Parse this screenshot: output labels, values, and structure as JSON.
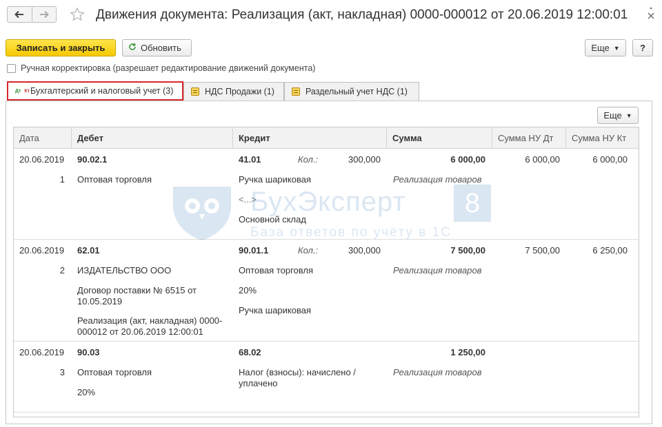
{
  "window": {
    "title": "Движения документа: Реализация (акт, накладная) 0000-000012 от 20.06.2019 12:00:01"
  },
  "toolbar": {
    "save_close_label": "Записать и закрыть",
    "refresh_label": "Обновить",
    "more_label": "Еще",
    "help_label": "?"
  },
  "manual_adjust_label": "Ручная корректировка (разрешает редактирование движений документа)",
  "tabs": [
    {
      "label": "Бухгалтерский и налоговый учет (3)",
      "active": true,
      "icon": "dt-kt-icon"
    },
    {
      "label": "НДС Продажи (1)",
      "active": false,
      "icon": "register-icon"
    },
    {
      "label": "Раздельный учет НДС (1)",
      "active": false,
      "icon": "register-icon"
    }
  ],
  "panel": {
    "more_label": "Еще"
  },
  "dtkt": {
    "dt": "Дт",
    "kt": "Кт"
  },
  "table": {
    "columns": [
      "Дата",
      "Дебет",
      "Кредит",
      "Сумма",
      "Сумма НУ Дт",
      "Сумма НУ Кт"
    ],
    "rows": [
      {
        "date": "20.06.2019",
        "num": "1",
        "debit_account": "90.02.1",
        "debit_lines": [
          "Оптовая торговля"
        ],
        "credit_account": "41.01",
        "qty_label": "Кол.:",
        "qty": "300,000",
        "credit_lines": [
          "Ручка шариковая",
          "<...>",
          "Основной склад"
        ],
        "sum": "6 000,00",
        "sum_note": "Реализация товаров",
        "nu_dt": "6 000,00",
        "nu_kt": "6 000,00"
      },
      {
        "date": "20.06.2019",
        "num": "2",
        "debit_account": "62.01",
        "debit_lines": [
          "ИЗДАТЕЛЬСТВО ООО",
          "Договор поставки № 6515 от 10.05.2019",
          "Реализация (акт, накладная) 0000-000012 от 20.06.2019 12:00:01"
        ],
        "credit_account": "90.01.1",
        "qty_label": "Кол.:",
        "qty": "300,000",
        "credit_lines": [
          "Оптовая торговля",
          "20%",
          "Ручка шариковая"
        ],
        "sum": "7 500,00",
        "sum_note": "Реализация товаров",
        "nu_dt": "7 500,00",
        "nu_kt": "6 250,00"
      },
      {
        "date": "20.06.2019",
        "num": "3",
        "debit_account": "90.03",
        "debit_lines": [
          "Оптовая торговля",
          "20%"
        ],
        "credit_account": "68.02",
        "credit_lines": [
          "Налог (взносы): начислено / уплачено"
        ],
        "sum": "1 250,00",
        "sum_note": "Реализация товаров",
        "nu_dt": "",
        "nu_kt": ""
      }
    ]
  },
  "watermark": {
    "brand": "БухЭксперт",
    "number": "8",
    "tagline": "База ответов по учёту в 1С"
  },
  "colors": {
    "primary_button": "#f5c800",
    "active_tab_border": "#d9262b",
    "watermark": "#5a8fc8"
  }
}
